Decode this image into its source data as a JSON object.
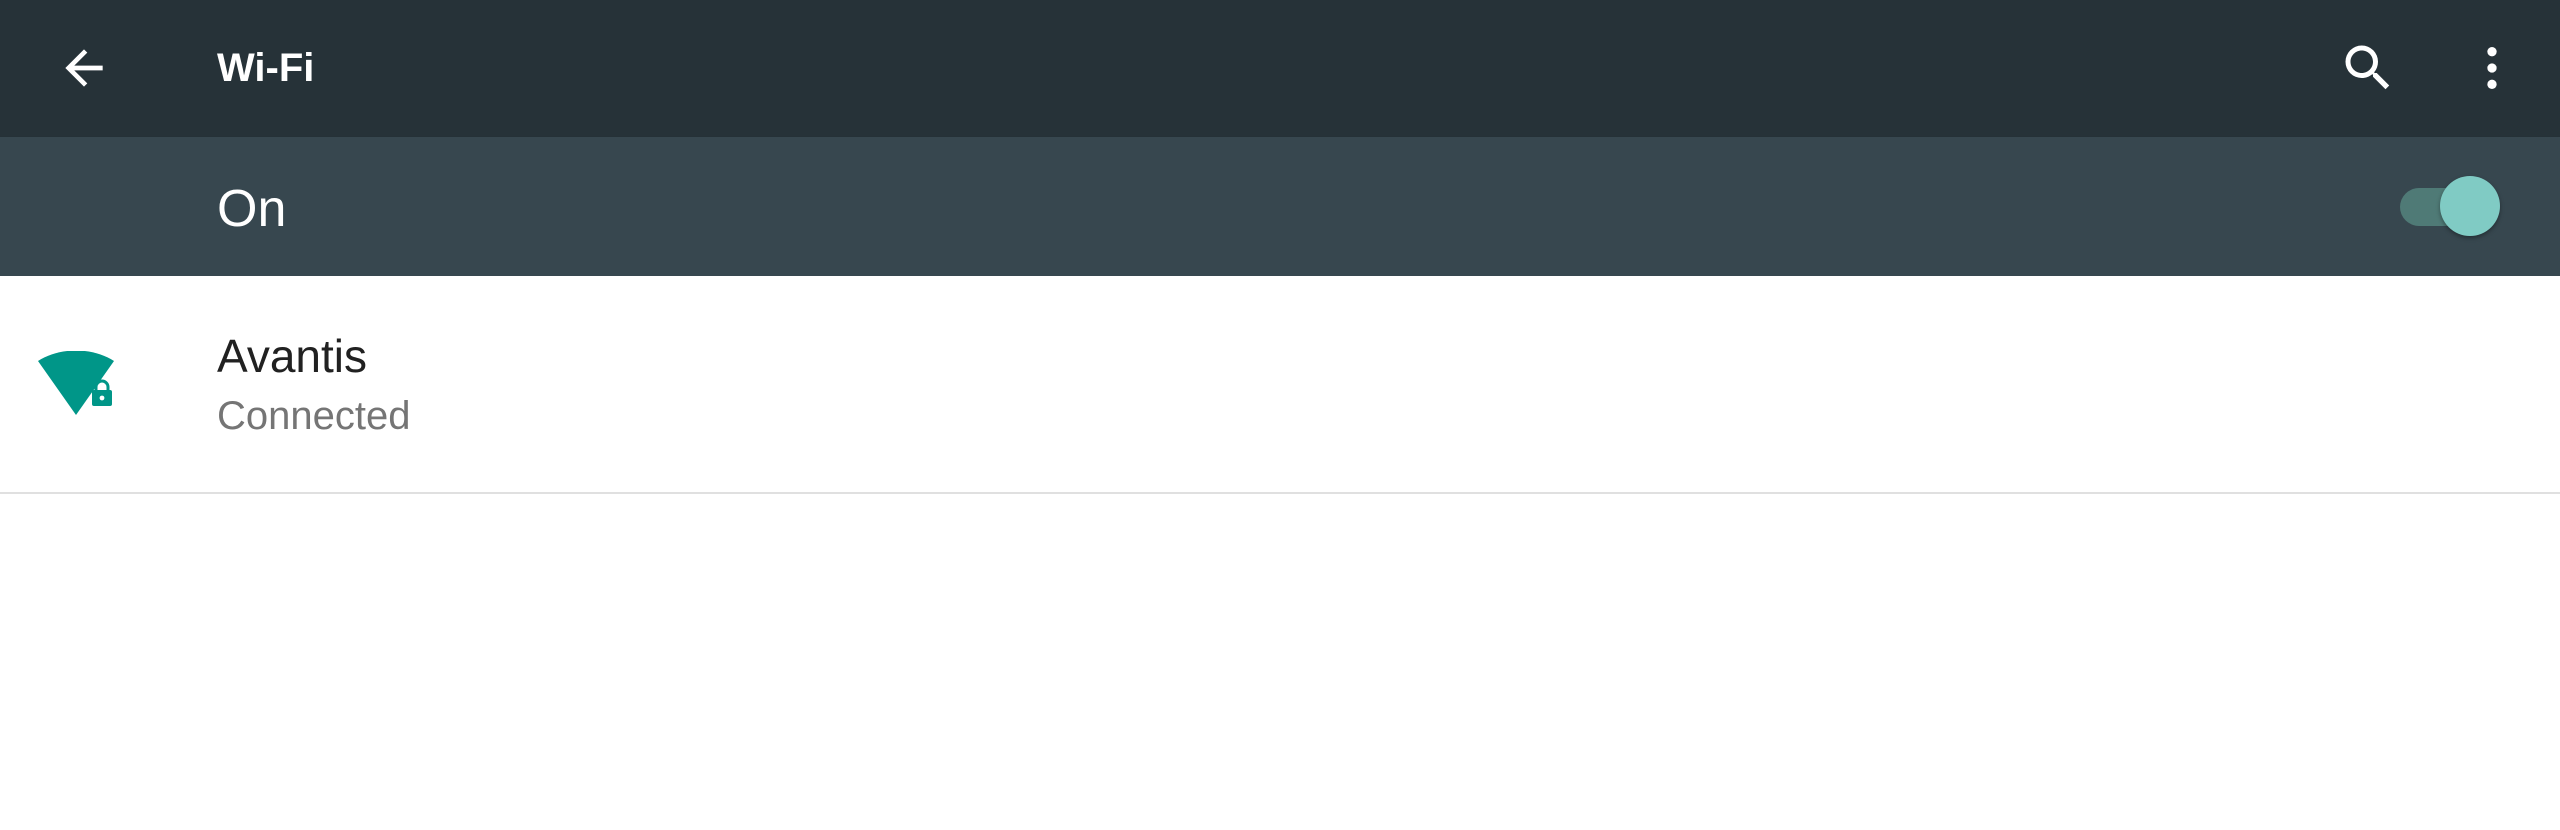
{
  "colors": {
    "toolbar_bg": "#263238",
    "switchbar_bg": "#37474f",
    "accent": "#009688",
    "toggle_thumb": "#80cbc4",
    "toggle_track": "#4f7a76",
    "primary_text": "#212121",
    "secondary_text": "#757575",
    "divider": "#e0e0e0"
  },
  "toolbar": {
    "back_icon": "arrow-back-icon",
    "title": "Wi-Fi",
    "search_icon": "search-icon",
    "more_icon": "more-vert-icon"
  },
  "master_switch": {
    "label": "On",
    "checked": true
  },
  "networks": [
    {
      "ssid": "Avantis",
      "status": "Connected",
      "icon": "wifi-signal-locked-icon",
      "secured": true
    }
  ]
}
